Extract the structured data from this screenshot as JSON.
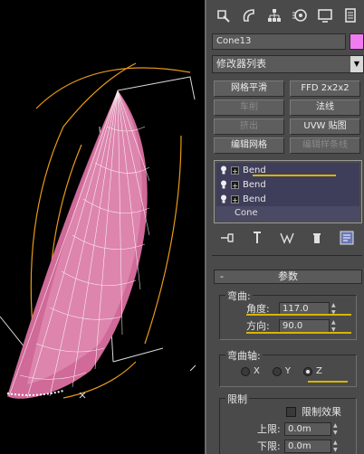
{
  "viewport": {
    "background": "#000000",
    "mesh_color": "#e87fb0",
    "gizmo_color": "#ffa500"
  },
  "command_panel": {
    "tabs": [
      "create-icon",
      "modify-icon",
      "hierarchy-icon",
      "motion-icon",
      "display-icon",
      "utilities-icon"
    ],
    "object_name": "Cone13",
    "object_color": "#f07cf0",
    "modifier_list_label": "修改器列表",
    "modifier_buttons": [
      {
        "label": "网格平滑",
        "enabled": true
      },
      {
        "label": "FFD 2x2x2",
        "enabled": true
      },
      {
        "label": "车削",
        "enabled": false
      },
      {
        "label": "法线",
        "enabled": true
      },
      {
        "label": "挤出",
        "enabled": false
      },
      {
        "label": "UVW 贴图",
        "enabled": true
      },
      {
        "label": "编辑网格",
        "enabled": true
      },
      {
        "label": "编辑样条线",
        "enabled": false
      }
    ],
    "modifier_stack": {
      "items": [
        "Bend",
        "Bend",
        "Bend"
      ],
      "base": "Cone"
    },
    "parameters": {
      "rollout_title": "参数",
      "rollout_toggle": "-",
      "bend_group": {
        "title": "弯曲:",
        "angle_label": "角度:",
        "angle_value": "117.0",
        "direction_label": "方向:",
        "direction_value": "90.0"
      },
      "axis_group": {
        "title": "弯曲轴:",
        "options": [
          "X",
          "Y",
          "Z"
        ],
        "selected": "Z"
      },
      "limits_group": {
        "title": "限制",
        "limit_effect_label": "限制效果",
        "upper_label": "上限:",
        "upper_value": "0.0m",
        "lower_label": "下限:",
        "lower_value": "0.0m"
      }
    }
  }
}
